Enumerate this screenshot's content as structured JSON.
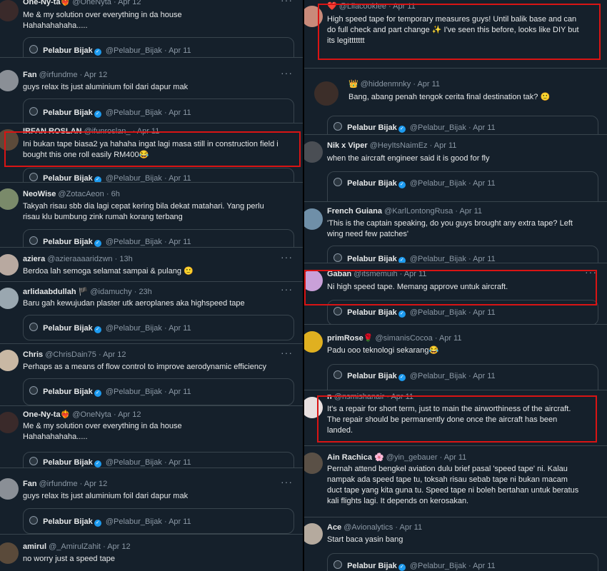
{
  "quoted_author": {
    "name": "Pelabur Bijak",
    "handle": "@Pelabur_Bijak",
    "date": "Apr 11"
  },
  "more_glyph": "···",
  "left": [
    {
      "name": "One-Ny-ta❤️‍🔥",
      "handle": "@OneNyta",
      "date": "Apr 12",
      "lines": [
        "Me & my solution over everything in da house",
        "Hahahahahaha....."
      ]
    },
    {
      "name": "Fan",
      "handle": "@irfundme",
      "date": "Apr 12",
      "lines": [
        "guys relax its just aluminium foil dari dapur mak"
      ]
    },
    {
      "name": "IRFAN ROSLAN",
      "handle": "@ifunroslan_",
      "date": "Apr 11",
      "lines": [
        "Ini bukan tape biasa2 ya hahaha ingat lagi masa still in construction field i",
        "bought this one roll easily RM400😂"
      ]
    },
    {
      "name": "NeoWise",
      "handle": "@ZotacAeon",
      "date": "6h",
      "lines": [
        "Takyah risau sbb dia lagi cepat kering bila dekat matahari. Yang perlu",
        "risau klu bumbung zink rumah korang terbang"
      ]
    },
    {
      "name": "aziera",
      "handle": "@azieraaaaridzwn",
      "date": "13h",
      "lines": [
        "Berdoa lah semoga selamat sampai & pulang 🙂"
      ]
    },
    {
      "name": "arlidaabdullah 🏴",
      "handle": "@idamuchy",
      "date": "23h",
      "lines": [
        "Baru gah kewujudan plaster utk aeroplanes aka highspeed tape"
      ]
    },
    {
      "name": "Chris",
      "handle": "@ChrisDain75",
      "date": "Apr 12",
      "lines": [
        "Perhaps as a means of flow control to improve aerodynamic efficiency"
      ]
    },
    {
      "name": "One-Ny-ta❤️‍🔥",
      "handle": "@OneNyta",
      "date": "Apr 12",
      "lines": [
        "Me & my solution over everything in da house",
        "Hahahahahaha....."
      ]
    },
    {
      "name": "Fan",
      "handle": "@irfundme",
      "date": "Apr 12",
      "lines": [
        "guys relax its just aluminium foil dari dapur mak"
      ]
    },
    {
      "name": "amirul",
      "handle": "@_AmirulZahit",
      "date": "Apr 12",
      "lines": [
        "no worry just a speed tape"
      ]
    }
  ],
  "right": [
    {
      "name": "❤️",
      "handle": "@Lilacookiee",
      "date": "Apr 11",
      "lines": [
        "High speed tape for temporary measures guys! Until balik base and can",
        "do full check and part change ✨ I've seen this before, looks like DIY but",
        "its legittttttt"
      ]
    },
    {
      "name": "👑",
      "handle": "@hiddenmnky",
      "date": "Apr 11",
      "lines": [
        "Bang, abang penah tengok cerita final destination tak? 🙂"
      ]
    },
    {
      "name": "Nik x Viper",
      "handle": "@HeyItsNaimEz",
      "date": "Apr 11",
      "lines": [
        "when the aircraft engineer said it is good for fly"
      ]
    },
    {
      "name": "French Guiana",
      "handle": "@KarlLontongRusa",
      "date": "Apr 11",
      "lines": [
        "'This is the captain speaking, do you guys brought any extra tape? Left",
        "wing need few patches'"
      ]
    },
    {
      "name": "Gaban",
      "handle": "@itsmemuih",
      "date": "Apr 11",
      "lines": [
        "Ni high speed tape. Memang approve untuk aircraft."
      ]
    },
    {
      "name": "primRose🌹",
      "handle": "@simanisCocoa",
      "date": "Apr 11",
      "lines": [
        "Padu ooo teknologi sekarang😂"
      ]
    },
    {
      "name": "n",
      "handle": "@nsmishanair",
      "date": "Apr 11",
      "lines": [
        "It's a repair for short term, just to main the airworthiness of the aircraft.",
        "The repair should be permanently done once the aircraft has been",
        "landed."
      ]
    },
    {
      "name": "Ain Rachica 🌸",
      "handle": "@yin_gebauer",
      "date": "Apr 11",
      "lines": [
        "Pernah attend bengkel aviation dulu brief pasal 'speed tape' ni. Kalau",
        "nampak ada speed tape tu, toksah risau sebab tape ni bukan macam",
        "duct tape yang kita guna tu.  Speed tape ni boleh bertahan untuk beratus",
        "kali flights lagi. It depends on kerosakan."
      ]
    },
    {
      "name": "Ace",
      "handle": "@Avionalytics",
      "date": "Apr 11",
      "lines": [
        "Start baca yasin bang"
      ]
    }
  ],
  "colors": {
    "background": "#15202b",
    "text": "#e7e9ea",
    "muted": "#8b98a5",
    "verified": "#1d9bf0",
    "highlight": "#d91414"
  }
}
